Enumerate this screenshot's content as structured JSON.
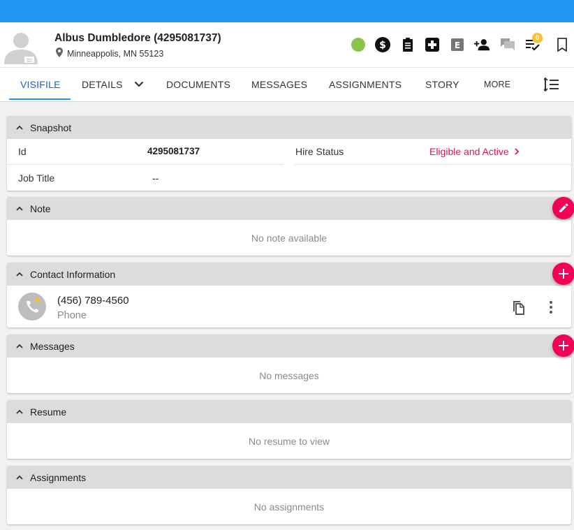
{
  "header": {
    "name": "Albus Dumbledore (4295081737)",
    "location": "Minneappolis, MN 55123",
    "notification_count": "0",
    "status_color": "#8bc34a",
    "icons": [
      "status-dot",
      "dollar-icon",
      "clipboard-icon",
      "medical-plus-icon",
      "e-verify-icon",
      "add-person-icon",
      "chat-icon",
      "checklist-icon",
      "bookmark-icon"
    ]
  },
  "tabs": {
    "items": [
      "VISIFILE",
      "DETAILS",
      "DOCUMENTS",
      "MESSAGES",
      "ASSIGNMENTS",
      "STORY"
    ],
    "more": "MORE",
    "active": "VISIFILE"
  },
  "snapshot": {
    "title": "Snapshot",
    "id_label": "Id",
    "id_value": "4295081737",
    "hire_label": "Hire Status",
    "hire_value": "Eligible and Active",
    "job_label": "Job Title",
    "job_value": "--"
  },
  "note": {
    "title": "Note",
    "empty": "No note available"
  },
  "contact": {
    "title": "Contact Information",
    "phone": "(456) 789-4560",
    "phone_type": "Phone"
  },
  "messages": {
    "title": "Messages",
    "empty": "No messages"
  },
  "resume": {
    "title": "Resume",
    "empty": "No resume to view"
  },
  "assignments": {
    "title": "Assignments",
    "empty": "No assignments"
  },
  "colors": {
    "topbar": "#2196f3",
    "accent": "#f50057",
    "link": "#e0115f"
  }
}
